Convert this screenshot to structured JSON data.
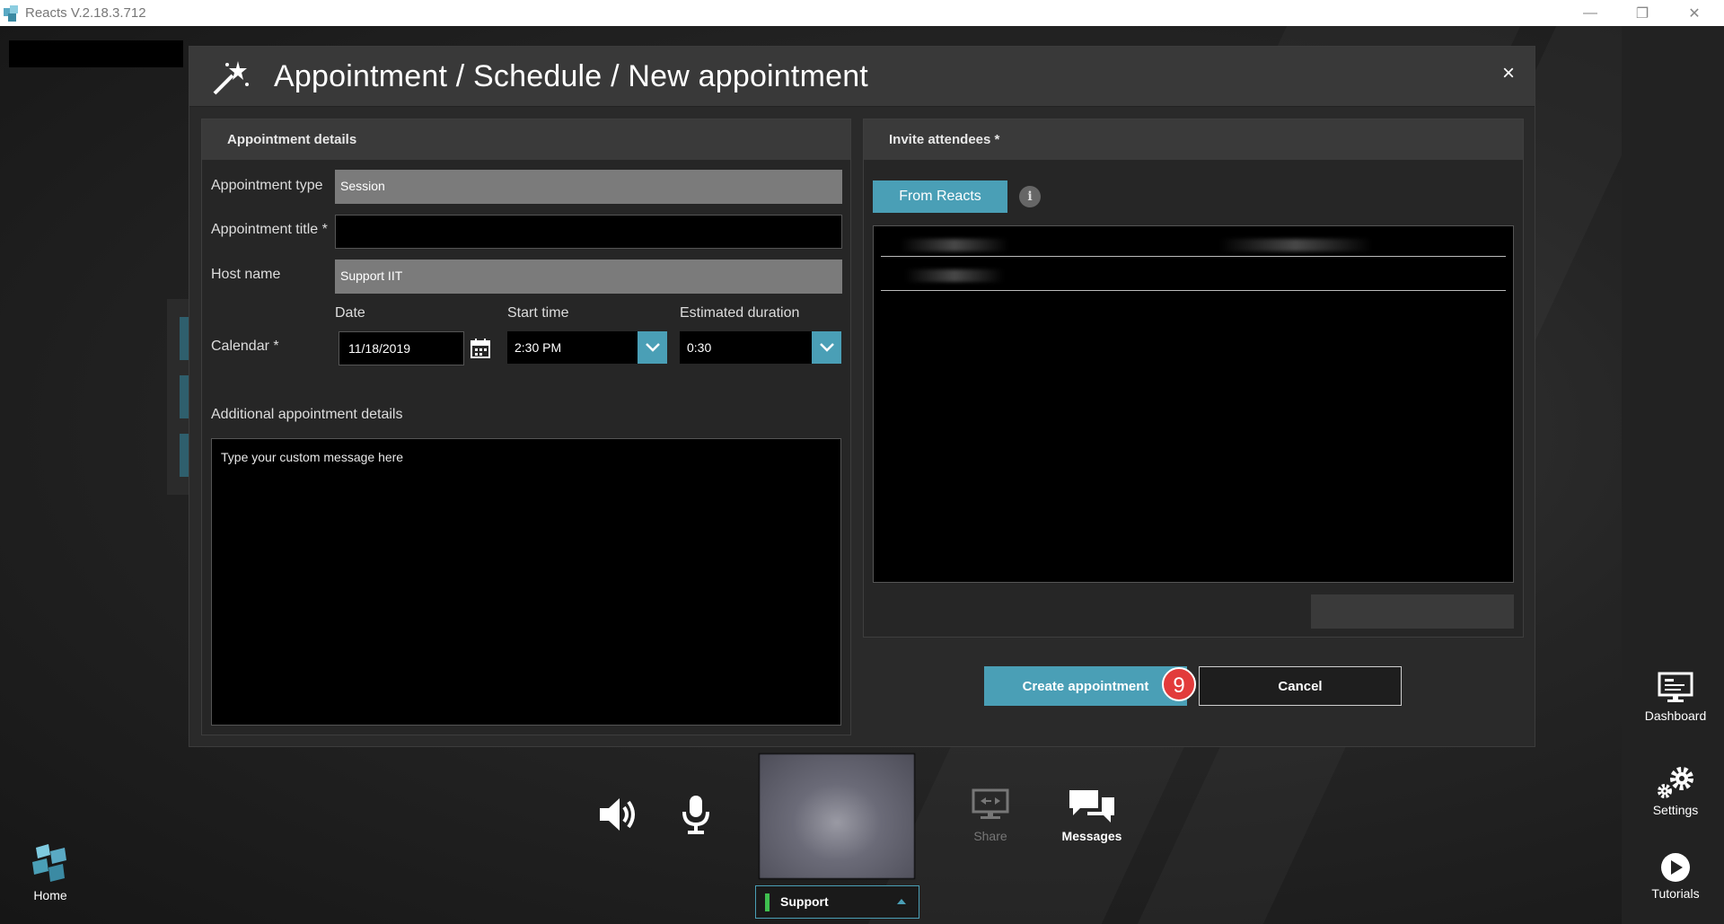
{
  "window": {
    "title": "Reacts V.2.18.3.712",
    "minimize": "—",
    "restore": "❐",
    "close": "✕"
  },
  "dialog": {
    "title": "Appointment / Schedule / New appointment",
    "close_label": "×",
    "details_panel": {
      "header": "Appointment details",
      "type_label": "Appointment type",
      "type_value": "Session",
      "title_label": "Appointment title *",
      "title_value": "",
      "host_label": "Host name",
      "host_value": "Support IIT",
      "calendar_label": "Calendar *",
      "date_label": "Date",
      "date_value": "11/18/2019",
      "start_label": "Start time",
      "start_value": "2:30 PM",
      "duration_label": "Estimated duration",
      "duration_value": "0:30",
      "additional_label": "Additional appointment details",
      "message_placeholder": "Type your custom message here"
    },
    "invite_panel": {
      "header": "Invite attendees *",
      "from_reacts": "From Reacts",
      "info_glyph": "i"
    },
    "create_label": "Create appointment",
    "cancel_label": "Cancel",
    "step_badge": "9"
  },
  "toolbar": {
    "share_label": "Share",
    "messages_label": "Messages",
    "user_label": "Support"
  },
  "nav": {
    "home_label": "Home",
    "dashboard_label": "Dashboard",
    "settings_label": "Settings",
    "tutorials_label": "Tutorials"
  },
  "colors": {
    "accent": "#4a9fb6",
    "presence": "#3fbf4f",
    "badge": "#e23b3b"
  }
}
